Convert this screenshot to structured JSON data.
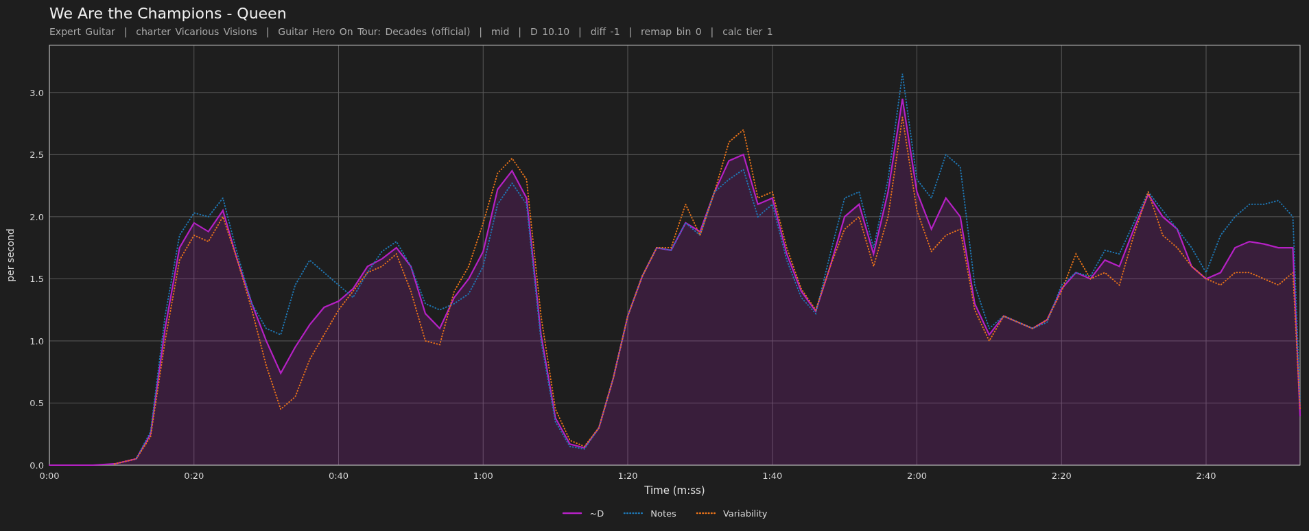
{
  "title": "We Are the Champions - Queen",
  "subtitle": "Expert Guitar  |  charter Vicarious Visions  |  Guitar Hero On Tour: Decades (official)  |  mid  |  D 10.10  |  diff -1  |  remap bin 0  |  calc tier 1",
  "chart_data": {
    "type": "line",
    "xlabel": "Time (m:ss)",
    "ylabel": "per second",
    "x": [
      0,
      3,
      6,
      9,
      12,
      14,
      16,
      18,
      20,
      22,
      24,
      26,
      28,
      30,
      32,
      34,
      36,
      38,
      40,
      42,
      44,
      46,
      48,
      50,
      52,
      54,
      56,
      58,
      60,
      62,
      64,
      66,
      68,
      70,
      72,
      74,
      76,
      78,
      80,
      82,
      84,
      86,
      88,
      90,
      92,
      94,
      96,
      98,
      100,
      102,
      104,
      106,
      108,
      110,
      112,
      114,
      116,
      118,
      120,
      122,
      124,
      126,
      128,
      130,
      132,
      134,
      136,
      138,
      140,
      142,
      144,
      146,
      148,
      150,
      152,
      154,
      156,
      158,
      160,
      162,
      164,
      166,
      168,
      170,
      172,
      173
    ],
    "series": [
      {
        "name": "~D",
        "color": "#b521c4",
        "line_style": "solid",
        "values": [
          0,
          0,
          0,
          0.01,
          0.05,
          0.25,
          1.1,
          1.75,
          1.95,
          1.88,
          2.05,
          1.65,
          1.3,
          1.0,
          0.74,
          0.95,
          1.13,
          1.27,
          1.32,
          1.42,
          1.6,
          1.66,
          1.75,
          1.6,
          1.22,
          1.1,
          1.35,
          1.5,
          1.72,
          2.22,
          2.37,
          2.15,
          1.05,
          0.38,
          0.17,
          0.14,
          0.3,
          0.7,
          1.2,
          1.52,
          1.75,
          1.73,
          1.95,
          1.88,
          2.2,
          2.45,
          2.5,
          2.1,
          2.15,
          1.7,
          1.4,
          1.24,
          1.6,
          2.0,
          2.1,
          1.7,
          2.2,
          2.95,
          2.2,
          1.9,
          2.15,
          2.0,
          1.3,
          1.05,
          1.2,
          1.15,
          1.1,
          1.17,
          1.42,
          1.55,
          1.5,
          1.65,
          1.6,
          1.9,
          2.18,
          2.0,
          1.9,
          1.6,
          1.5,
          1.55,
          1.75,
          1.8,
          1.78,
          1.75,
          1.75,
          0.4
        ]
      },
      {
        "name": "Notes",
        "color": "#1f77b4",
        "line_style": "dotted",
        "values": [
          null,
          null,
          null,
          null,
          0.05,
          0.27,
          1.2,
          1.85,
          2.03,
          2.0,
          2.15,
          1.7,
          1.3,
          1.1,
          1.05,
          1.45,
          1.65,
          1.55,
          1.45,
          1.35,
          1.55,
          1.72,
          1.8,
          1.6,
          1.3,
          1.25,
          1.3,
          1.38,
          1.6,
          2.1,
          2.27,
          2.1,
          1.0,
          0.35,
          0.15,
          0.13,
          0.3,
          0.7,
          1.2,
          1.52,
          1.75,
          1.73,
          1.95,
          1.85,
          2.2,
          2.3,
          2.38,
          2.0,
          2.1,
          1.65,
          1.35,
          1.22,
          1.7,
          2.15,
          2.2,
          1.75,
          2.3,
          3.15,
          2.3,
          2.15,
          2.5,
          2.4,
          1.45,
          1.1,
          1.2,
          1.15,
          1.1,
          1.15,
          1.45,
          1.55,
          1.52,
          1.73,
          1.7,
          1.95,
          2.2,
          2.05,
          1.9,
          1.75,
          1.55,
          1.85,
          2.0,
          2.1,
          2.1,
          2.13,
          2.0,
          0.5
        ]
      },
      {
        "name": "Variability",
        "color": "#e8731a",
        "line_style": "dotted",
        "values": [
          null,
          null,
          null,
          0.01,
          0.05,
          0.23,
          1.0,
          1.65,
          1.85,
          1.8,
          2.0,
          1.65,
          1.25,
          0.8,
          0.45,
          0.55,
          0.85,
          1.05,
          1.25,
          1.4,
          1.55,
          1.6,
          1.7,
          1.4,
          1.0,
          0.97,
          1.4,
          1.6,
          1.95,
          2.35,
          2.47,
          2.3,
          1.2,
          0.45,
          0.2,
          0.15,
          0.3,
          0.7,
          1.2,
          1.52,
          1.75,
          1.75,
          2.1,
          1.85,
          2.2,
          2.6,
          2.7,
          2.15,
          2.2,
          1.75,
          1.42,
          1.25,
          1.6,
          1.9,
          2.0,
          1.6,
          2.0,
          2.8,
          2.05,
          1.72,
          1.85,
          1.9,
          1.25,
          1.0,
          1.2,
          1.15,
          1.1,
          1.17,
          1.4,
          1.7,
          1.5,
          1.55,
          1.45,
          1.85,
          2.2,
          1.85,
          1.75,
          1.6,
          1.5,
          1.45,
          1.55,
          1.55,
          1.5,
          1.45,
          1.55,
          0.45
        ]
      }
    ],
    "grid": true,
    "xlim": [
      0,
      173
    ],
    "ylim": [
      0,
      3.38
    ],
    "xticks": [
      {
        "value": 0,
        "label": "0:00"
      },
      {
        "value": 20,
        "label": "0:20"
      },
      {
        "value": 40,
        "label": "0:40"
      },
      {
        "value": 60,
        "label": "1:00"
      },
      {
        "value": 80,
        "label": "1:20"
      },
      {
        "value": 100,
        "label": "1:40"
      },
      {
        "value": 120,
        "label": "2:00"
      },
      {
        "value": 140,
        "label": "2:20"
      },
      {
        "value": 160,
        "label": "2:40"
      }
    ],
    "yticks": [
      {
        "value": 0,
        "label": "0.0"
      },
      {
        "value": 0.5,
        "label": "0.5"
      },
      {
        "value": 1,
        "label": "1.0"
      },
      {
        "value": 1.5,
        "label": "1.5"
      },
      {
        "value": 2,
        "label": "2.0"
      },
      {
        "value": 2.5,
        "label": "2.5"
      },
      {
        "value": 3,
        "label": "3.0"
      }
    ]
  }
}
